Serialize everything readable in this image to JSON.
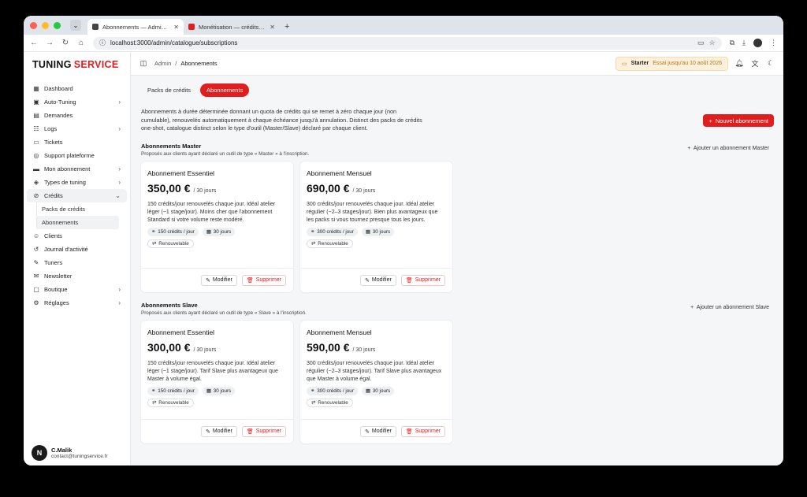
{
  "browser": {
    "tabs": [
      {
        "title": "Abonnements — Admin · Tuni",
        "active": true,
        "favicon_color": "#444444"
      },
      {
        "title": "Monétisation — crédits, abon",
        "active": false,
        "favicon_color": "#e11d1d"
      }
    ],
    "url": "localhost:3000/admin/catalogue/subscriptions"
  },
  "brand": {
    "part1": "TUNING",
    "part2": "SERVICE"
  },
  "sidebar": {
    "items": [
      {
        "label": "Dashboard",
        "icon": "dashboard-icon",
        "glyph": "▦",
        "chevron": false
      },
      {
        "label": "Auto-Tuning",
        "icon": "cpu-icon",
        "glyph": "▣",
        "chevron": true
      },
      {
        "label": "Demandes",
        "icon": "inbox-icon",
        "glyph": "▤",
        "chevron": false
      },
      {
        "label": "Logs",
        "icon": "logs-icon",
        "glyph": "☷",
        "chevron": true
      },
      {
        "label": "Tickets",
        "icon": "ticket-icon",
        "glyph": "▭",
        "chevron": false
      },
      {
        "label": "Support plateforme",
        "icon": "support-icon",
        "glyph": "◎",
        "chevron": false
      },
      {
        "label": "Mon abonnement",
        "icon": "card-icon",
        "glyph": "▬",
        "chevron": true
      },
      {
        "label": "Types de tuning",
        "icon": "tag-icon",
        "glyph": "◈",
        "chevron": true
      }
    ],
    "credits": {
      "label": "Crédits",
      "icon": "credits-icon",
      "glyph": "⊘",
      "sub": [
        "Packs de crédits",
        "Abonnements"
      ]
    },
    "items2": [
      {
        "label": "Clients",
        "icon": "users-icon",
        "glyph": "☺",
        "chevron": false
      },
      {
        "label": "Journal d'activité",
        "icon": "history-icon",
        "glyph": "↺",
        "chevron": false
      },
      {
        "label": "Tuners",
        "icon": "wrench-icon",
        "glyph": "✎",
        "chevron": false
      },
      {
        "label": "Newsletter",
        "icon": "mail-icon",
        "glyph": "✉",
        "chevron": false
      },
      {
        "label": "Boutique",
        "icon": "shop-icon",
        "glyph": "▢",
        "chevron": true
      },
      {
        "label": "Réglages",
        "icon": "settings-icon",
        "glyph": "⚙",
        "chevron": true
      }
    ],
    "user": {
      "initial": "N",
      "name": "C.Malik",
      "email": "contact@tuningservice.fr"
    }
  },
  "topbar": {
    "breadcrumb_root": "Admin",
    "breadcrumb_sep": "/",
    "breadcrumb_current": "Abonnements",
    "plan_name": "Starter",
    "plan_trial": "Essai jusqu'au 10 août 2026"
  },
  "tabs": {
    "packs": "Packs de crédits",
    "abonnements": "Abonnements"
  },
  "intro": "Abonnements à durée déterminée donnant un quota de crédits qui se remet à zéro chaque jour (non cumulable), renouvelés automatiquement à chaque échéance jusqu'à annulation. Distinct des packs de crédits one-shot, catalogue distinct selon le type d'outil (Master/Slave) déclaré par chaque client.",
  "new_button": "Nouvel abonnement",
  "sections": [
    {
      "title": "Abonnements Master",
      "subtitle": "Proposés aux clients ayant déclaré un outil de type « Master » à l'inscription.",
      "add_label": "Ajouter un abonnement Master",
      "cards": [
        {
          "name": "Abonnement Essentiel",
          "price": "350,00 €",
          "period": "/ 30 jours",
          "desc": "150 crédits/jour renouvelés chaque jour. Idéal atelier léger (~1 stage/jour). Moins cher que l'abonnement Standard si votre volume reste modéré.",
          "chip_credits": "150 crédits / jour",
          "chip_days": "30 jours",
          "chip_renew": "Renouvelable"
        },
        {
          "name": "Abonnement Mensuel",
          "price": "690,00 €",
          "period": "/ 30 jours",
          "desc": "300 crédits/jour renouvelés chaque jour. Idéal atelier régulier (~2–3 stages/jour). Bien plus avantageux que les packs si vous tournez presque tous les jours.",
          "chip_credits": "300 crédits / jour",
          "chip_days": "30 jours",
          "chip_renew": "Renouvelable"
        }
      ]
    },
    {
      "title": "Abonnements Slave",
      "subtitle": "Proposés aux clients ayant déclaré un outil de type « Slave » à l'inscription.",
      "add_label": "Ajouter un abonnement Slave",
      "cards": [
        {
          "name": "Abonnement Essentiel",
          "price": "300,00 €",
          "period": "/ 30 jours",
          "desc": "150 crédits/jour renouvelés chaque jour. Idéal atelier léger (~1 stage/jour). Tarif Slave plus avantageux que Master à volume égal.",
          "chip_credits": "150 crédits / jour",
          "chip_days": "30 jours",
          "chip_renew": "Renouvelable"
        },
        {
          "name": "Abonnement Mensuel",
          "price": "590,00 €",
          "period": "/ 30 jours",
          "desc": "300 crédits/jour renouvelés chaque jour. Idéal atelier régulier (~2–3 stages/jour). Tarif Slave plus avantageux que Master à volume égal.",
          "chip_credits": "300 crédits / jour",
          "chip_days": "30 jours",
          "chip_renew": "Renouvelable"
        }
      ]
    }
  ],
  "card_actions": {
    "edit": "Modifier",
    "delete": "Supprimer"
  },
  "colors": {
    "accent": "#e11d1d",
    "plan_bg": "#fdf0dd",
    "plan_text": "#b8761a"
  }
}
